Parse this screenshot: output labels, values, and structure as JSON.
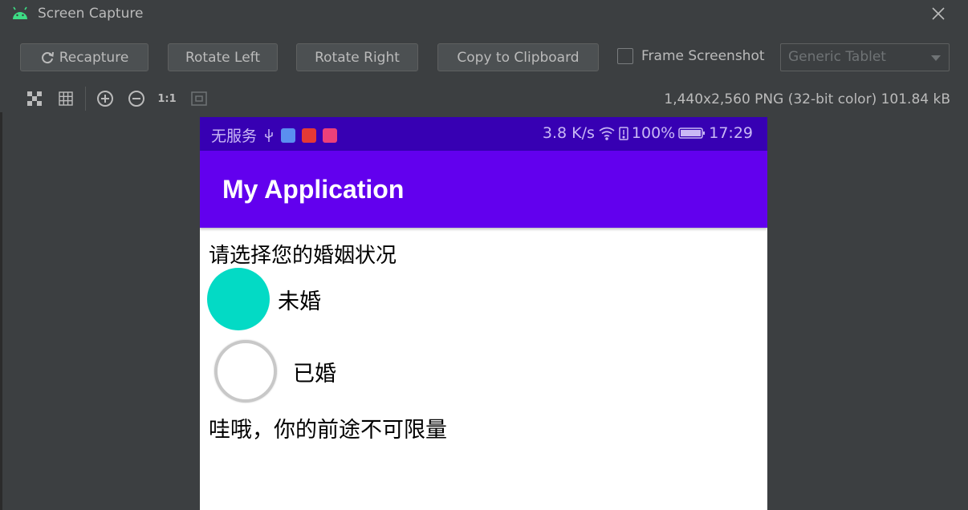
{
  "window": {
    "title": "Screen Capture",
    "close_icon": "close-icon",
    "logo_icon": "android-icon"
  },
  "toolbar": {
    "recapture_label": "Recapture",
    "rotate_left_label": "Rotate Left",
    "rotate_right_label": "Rotate Right",
    "copy_label": "Copy to Clipboard",
    "frame_screenshot_label": "Frame Screenshot",
    "frame_screenshot_checked": false,
    "device_select_value": "Generic Tablet"
  },
  "iconbar": {
    "icons": [
      "checkerboard-icon",
      "grid-icon",
      "zoom-in-icon",
      "zoom-out-icon",
      "actual-size-icon",
      "fit-screen-icon"
    ],
    "one_to_one_label": "1:1",
    "image_info": "1,440x2,560 PNG (32-bit color) 101.84 kB"
  },
  "phone": {
    "statusbar": {
      "carrier": "无服务",
      "speed": "3.8 K/s",
      "battery": "100%",
      "time": "17:29"
    },
    "appbar_title": "My Application",
    "prompt": "请选择您的婚姻状况",
    "options": [
      {
        "label": "未婚",
        "selected": true
      },
      {
        "label": "已婚",
        "selected": false
      }
    ],
    "result": "哇哦，你的前途不可限量"
  },
  "colors": {
    "ide_bg": "#3c3f41",
    "status_bar": "#3700b3",
    "app_bar": "#6200ee",
    "radio_accent": "#03dac5"
  }
}
